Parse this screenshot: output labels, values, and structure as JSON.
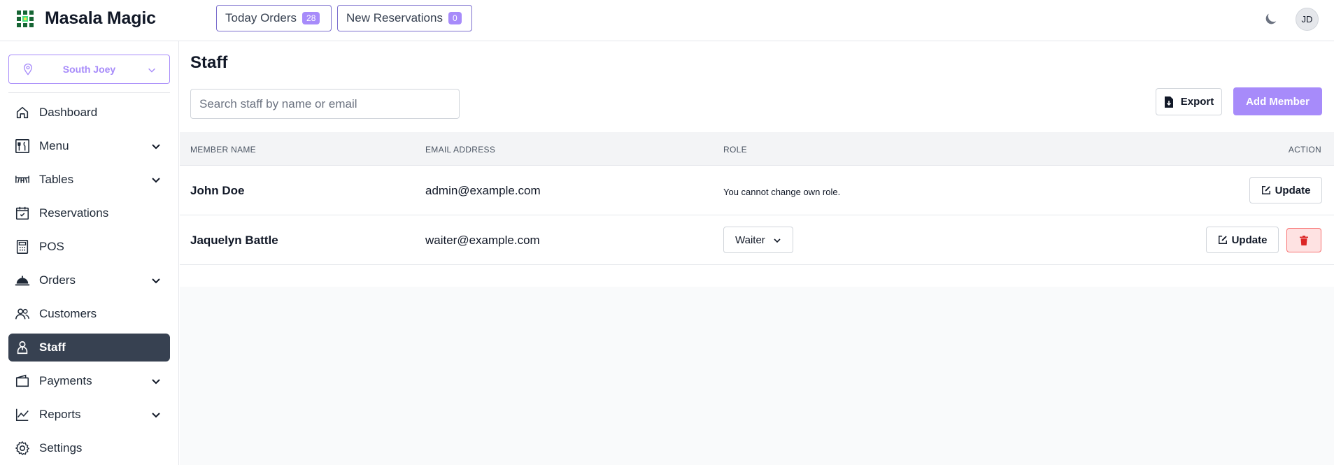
{
  "header": {
    "app_name": "Masala Magic",
    "today_orders_label": "Today Orders",
    "today_orders_count": "28",
    "new_reservations_label": "New Reservations",
    "new_reservations_count": "0",
    "user_initials": "JD"
  },
  "sidebar": {
    "branch": "South Joey",
    "items": [
      {
        "label": "Dashboard",
        "icon": "home-icon",
        "expandable": false
      },
      {
        "label": "Menu",
        "icon": "menu-book-icon",
        "expandable": true
      },
      {
        "label": "Tables",
        "icon": "table-icon",
        "expandable": true
      },
      {
        "label": "Reservations",
        "icon": "calendar-check-icon",
        "expandable": false
      },
      {
        "label": "POS",
        "icon": "pos-terminal-icon",
        "expandable": false
      },
      {
        "label": "Orders",
        "icon": "cloche-icon",
        "expandable": true
      },
      {
        "label": "Customers",
        "icon": "users-icon",
        "expandable": false
      },
      {
        "label": "Staff",
        "icon": "staff-icon",
        "expandable": false,
        "active": true
      },
      {
        "label": "Payments",
        "icon": "wallet-icon",
        "expandable": true
      },
      {
        "label": "Reports",
        "icon": "chart-line-icon",
        "expandable": true
      },
      {
        "label": "Settings",
        "icon": "gear-icon",
        "expandable": false
      }
    ]
  },
  "main": {
    "title": "Staff",
    "search_placeholder": "Search staff by name or email",
    "export_label": "Export",
    "add_member_label": "Add Member",
    "columns": [
      "Member Name",
      "Email Address",
      "Role",
      "Action"
    ],
    "rows": [
      {
        "name": "John Doe",
        "email": "admin@example.com",
        "role_note": "You cannot change own role.",
        "update_label": "Update"
      },
      {
        "name": "Jaquelyn Battle",
        "email": "waiter@example.com",
        "role": "Waiter",
        "update_label": "Update"
      }
    ]
  },
  "colors": {
    "accent": "#a78bfa",
    "active_nav": "#374151",
    "danger": "#dc2626"
  }
}
